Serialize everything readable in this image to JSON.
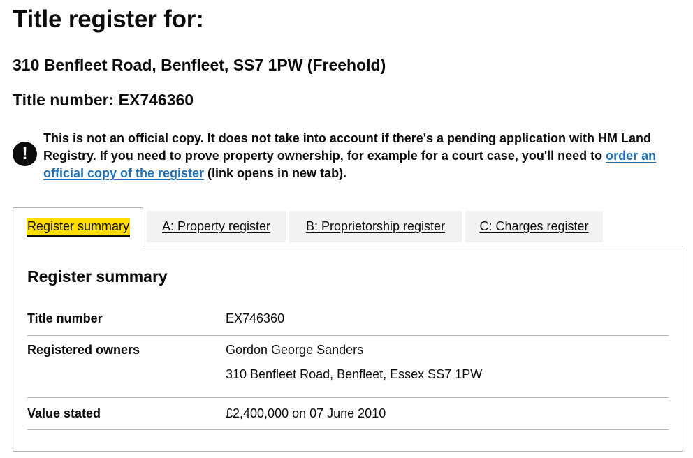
{
  "page_title": "Title register for:",
  "property_address": "310 Benfleet Road, Benfleet, SS7 1PW (Freehold)",
  "title_number_heading": "Title number: EX746360",
  "warning": {
    "icon": "!",
    "text_before": "This is not an official copy. It does not take into account if there's a pending application with HM Land Registry. If you need to prove property ownership, for example for a court case, you'll need to ",
    "link_text": "order an official copy of the register",
    "text_after": " (link opens in new tab)."
  },
  "tabs": [
    {
      "label": "Register summary"
    },
    {
      "label": "A: Property register"
    },
    {
      "label": "B: Proprietorship register"
    },
    {
      "label": "C: Charges register"
    }
  ],
  "summary": {
    "heading": "Register summary",
    "title_number": {
      "key": "Title number",
      "value": "EX746360"
    },
    "owners": {
      "key": "Registered owners",
      "name": "Gordon George Sanders",
      "address": "310 Benfleet Road, Benfleet, Essex SS7 1PW"
    },
    "value": {
      "key": "Value stated",
      "value": "£2,400,000 on 07 June 2010"
    }
  },
  "colors": {
    "focus_yellow": "#ffdd00",
    "link_blue": "#1d70b8",
    "text": "#0b0c0c",
    "border": "#b1b4b6",
    "tab_bg": "#f3f2f1"
  }
}
